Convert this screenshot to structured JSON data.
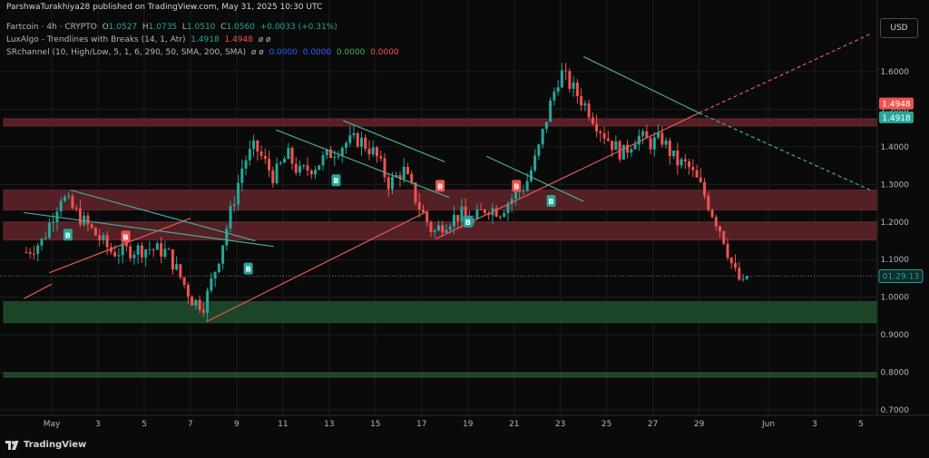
{
  "header": {
    "publisher": "ParshwaTurakhiya28 published on TradingView.com, May 31, 2025 10:30 UTC"
  },
  "legend": {
    "symbol": "Fartcoin · 4h · CRYPTO",
    "o_label": "O",
    "o_value": "1.0527",
    "h_label": "H",
    "h_value": "1.0735",
    "l_label": "L",
    "l_value": "1.0510",
    "c_label": "C",
    "c_value": "1.0560",
    "change": "+0.0033 (+0.31%)",
    "lux_name": "LuxAlgo - Trendlines with Breaks (14, 1, Atr)",
    "lux_v1": "1.4918",
    "lux_v2": "1.4948",
    "lux_extra": "ø ø",
    "sr_name": "SRchannel (10, High/Low, 5, 1, 6, 290, 50, SMA, 200, SMA)",
    "sr_extra": "ø ø",
    "sr_v1": "0.0000",
    "sr_v2": "0.0000",
    "sr_v3": "0.0000",
    "sr_v4": "0.0000"
  },
  "currency": "USD",
  "brand": "TradingView",
  "colors": {
    "background": "#0a0a0a",
    "up": "#26a69a",
    "down": "#ef5350",
    "resistance_zone": "#5c2228",
    "support_zone": "#1e4a2a",
    "trend_up": "#e05a55",
    "trend_down": "#4aa89a",
    "grid": "#1c1c1c"
  },
  "chart_data": {
    "type": "candlestick",
    "symbol": "Fartcoin",
    "timeframe": "4h",
    "ylim": [
      0.7,
      1.7
    ],
    "yticks": [
      "1.6000",
      "1.5000",
      "1.4000",
      "1.3000",
      "1.2000",
      "1.1000",
      "1.0000",
      "0.9000",
      "0.8000",
      "0.7000"
    ],
    "ytick_values": [
      1.6,
      1.5,
      1.4,
      1.3,
      1.2,
      1.1,
      1.0,
      0.9,
      0.8,
      0.7
    ],
    "xlim": [
      -0.2,
      36.4
    ],
    "xticks": [
      {
        "label": "May",
        "day": 1
      },
      {
        "label": "3",
        "day": 3
      },
      {
        "label": "5",
        "day": 5
      },
      {
        "label": "7",
        "day": 7
      },
      {
        "label": "9",
        "day": 9
      },
      {
        "label": "11",
        "day": 11
      },
      {
        "label": "13",
        "day": 13
      },
      {
        "label": "15",
        "day": 15
      },
      {
        "label": "17",
        "day": 17
      },
      {
        "label": "19",
        "day": 19
      },
      {
        "label": "21",
        "day": 21
      },
      {
        "label": "23",
        "day": 23
      },
      {
        "label": "25",
        "day": 25
      },
      {
        "label": "27",
        "day": 27
      },
      {
        "label": "29",
        "day": 29
      },
      {
        "label": "Jun",
        "day": 32
      },
      {
        "label": "3",
        "day": 34
      },
      {
        "label": "5",
        "day": 36
      }
    ],
    "price_path": [
      [
        -0.1,
        1.12
      ],
      [
        0.6,
        1.15
      ],
      [
        1.4,
        1.27
      ],
      [
        2.4,
        1.2
      ],
      [
        3.6,
        1.12
      ],
      [
        5.2,
        1.13
      ],
      [
        6.0,
        1.12
      ],
      [
        7.1,
        0.99
      ],
      [
        7.6,
        0.98
      ],
      [
        8.2,
        1.1
      ],
      [
        8.8,
        1.24
      ],
      [
        9.3,
        1.36
      ],
      [
        9.8,
        1.4
      ],
      [
        10.6,
        1.32
      ],
      [
        11.2,
        1.38
      ],
      [
        11.7,
        1.33
      ],
      [
        12.4,
        1.35
      ],
      [
        13.0,
        1.38
      ],
      [
        13.7,
        1.41
      ],
      [
        14.3,
        1.42
      ],
      [
        15.0,
        1.38
      ],
      [
        15.6,
        1.3
      ],
      [
        16.2,
        1.34
      ],
      [
        16.9,
        1.24
      ],
      [
        17.5,
        1.17
      ],
      [
        18.0,
        1.2
      ],
      [
        18.7,
        1.22
      ],
      [
        19.2,
        1.2
      ],
      [
        19.8,
        1.24
      ],
      [
        20.4,
        1.23
      ],
      [
        21.0,
        1.27
      ],
      [
        21.5,
        1.3
      ],
      [
        22.0,
        1.38
      ],
      [
        22.5,
        1.5
      ],
      [
        23.0,
        1.6
      ],
      [
        23.6,
        1.55
      ],
      [
        24.2,
        1.5
      ],
      [
        24.7,
        1.45
      ],
      [
        25.2,
        1.41
      ],
      [
        25.7,
        1.38
      ],
      [
        26.3,
        1.43
      ],
      [
        26.9,
        1.41
      ],
      [
        27.4,
        1.42
      ],
      [
        28.0,
        1.36
      ],
      [
        28.5,
        1.35
      ],
      [
        29.1,
        1.29
      ],
      [
        29.6,
        1.22
      ],
      [
        30.0,
        1.17
      ],
      [
        30.5,
        1.07
      ],
      [
        30.9,
        1.03
      ],
      [
        31.2,
        1.056
      ]
    ],
    "last_price": {
      "value": 1.056,
      "label": "1.0560",
      "countdown": "01:29:13"
    },
    "trendline_labels": [
      {
        "value": 1.4948,
        "label": "1.4948",
        "color": "#ef5350"
      },
      {
        "value": 1.4918,
        "label": "1.4918",
        "color": "#26a69a"
      }
    ],
    "zones": [
      {
        "kind": "resistance",
        "from": 1.455,
        "to": 1.475
      },
      {
        "kind": "resistance",
        "from": 1.232,
        "to": 1.285
      },
      {
        "kind": "resistance",
        "from": 1.152,
        "to": 1.2
      },
      {
        "kind": "support",
        "from": 0.932,
        "to": 0.988
      },
      {
        "kind": "support",
        "from": 0.787,
        "to": 0.799
      }
    ],
    "trendlines": [
      {
        "dir": "up",
        "x1": -0.2,
        "y1": 0.996,
        "x2": 1.0,
        "y2": 1.035
      },
      {
        "dir": "up",
        "x1": 0.9,
        "y1": 1.065,
        "x2": 7.0,
        "y2": 1.21
      },
      {
        "dir": "up",
        "x1": 7.7,
        "y1": 0.935,
        "x2": 17.3,
        "y2": 1.23
      },
      {
        "dir": "up",
        "x1": 17.6,
        "y1": 1.155,
        "x2": 29.0,
        "y2": 1.49
      },
      {
        "dir": "up-extended",
        "x1": 29.0,
        "y1": 1.49,
        "x2": 36.4,
        "y2": 1.7
      },
      {
        "dir": "down",
        "x1": -0.2,
        "y1": 1.225,
        "x2": 10.6,
        "y2": 1.135
      },
      {
        "dir": "down",
        "x1": 1.8,
        "y1": 1.285,
        "x2": 9.8,
        "y2": 1.15
      },
      {
        "dir": "down",
        "x1": 10.7,
        "y1": 1.445,
        "x2": 18.2,
        "y2": 1.265
      },
      {
        "dir": "down",
        "x1": 13.6,
        "y1": 1.47,
        "x2": 18.0,
        "y2": 1.36
      },
      {
        "dir": "down",
        "x1": 19.8,
        "y1": 1.375,
        "x2": 24.0,
        "y2": 1.255
      },
      {
        "dir": "down",
        "x1": 24.0,
        "y1": 1.64,
        "x2": 29.0,
        "y2": 1.49
      },
      {
        "dir": "down-extended",
        "x1": 29.0,
        "y1": 1.49,
        "x2": 36.4,
        "y2": 1.285
      }
    ],
    "break_markers": [
      {
        "label": "B",
        "kind": "buy",
        "x": 1.7,
        "y": 1.165
      },
      {
        "label": "B",
        "kind": "sell",
        "x": 4.2,
        "y": 1.16
      },
      {
        "label": "B",
        "kind": "buy",
        "x": 9.5,
        "y": 1.075
      },
      {
        "label": "B",
        "kind": "buy",
        "x": 13.3,
        "y": 1.31
      },
      {
        "label": "B",
        "kind": "sell",
        "x": 17.8,
        "y": 1.295
      },
      {
        "label": "B",
        "kind": "buy",
        "x": 19.0,
        "y": 1.2
      },
      {
        "label": "B",
        "kind": "sell",
        "x": 21.1,
        "y": 1.295
      },
      {
        "label": "B",
        "kind": "buy",
        "x": 22.6,
        "y": 1.255
      }
    ]
  }
}
